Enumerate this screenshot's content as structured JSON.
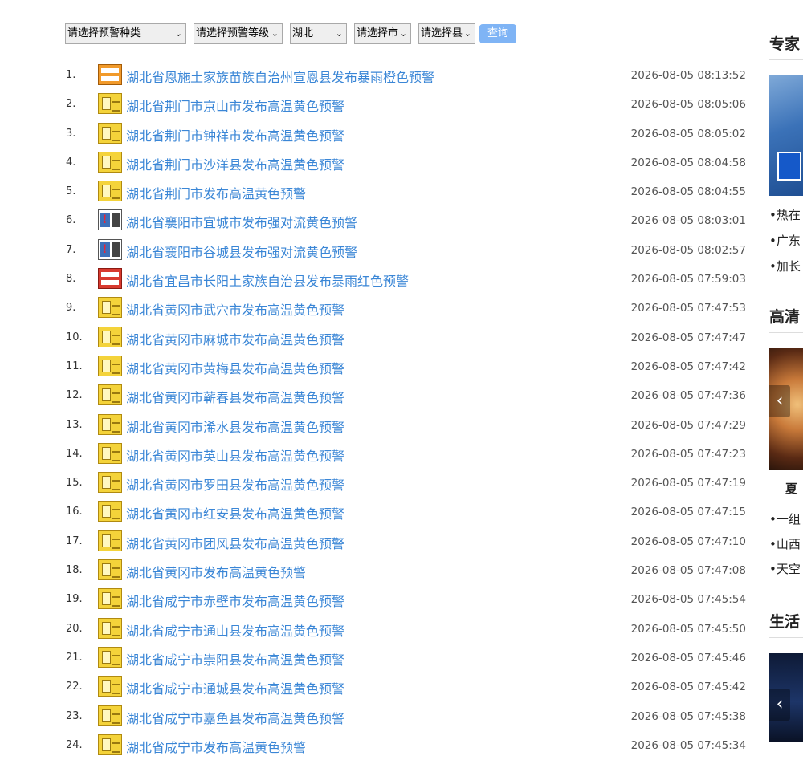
{
  "filters": {
    "category": "请选择预警种类",
    "level": "请选择预警等级",
    "province": "湖北",
    "city": "请选择市",
    "county": "请选择县",
    "query_label": "查询"
  },
  "alerts": [
    {
      "num": "1.",
      "icon": "orange-rainstorm-icon",
      "title": "湖北省恩施土家族苗族自治州宣恩县发布暴雨橙色预警",
      "time": "2026-08-05 08:13:52"
    },
    {
      "num": "2.",
      "icon": "yellow-heat-icon",
      "title": "湖北省荆门市京山市发布高温黄色预警",
      "time": "2026-08-05 08:05:06"
    },
    {
      "num": "3.",
      "icon": "yellow-heat-icon",
      "title": "湖北省荆门市钟祥市发布高温黄色预警",
      "time": "2026-08-05 08:05:02"
    },
    {
      "num": "4.",
      "icon": "yellow-heat-icon",
      "title": "湖北省荆门市沙洋县发布高温黄色预警",
      "time": "2026-08-05 08:04:58"
    },
    {
      "num": "5.",
      "icon": "yellow-heat-icon",
      "title": "湖北省荆门市发布高温黄色预警",
      "time": "2026-08-05 08:04:55"
    },
    {
      "num": "6.",
      "icon": "convection-alert-icon",
      "title": "湖北省襄阳市宜城市发布强对流黄色预警",
      "time": "2026-08-05 08:03:01"
    },
    {
      "num": "7.",
      "icon": "convection-alert-icon",
      "title": "湖北省襄阳市谷城县发布强对流黄色预警",
      "time": "2026-08-05 08:02:57"
    },
    {
      "num": "8.",
      "icon": "red-rainstorm-icon",
      "title": "湖北省宜昌市长阳土家族自治县发布暴雨红色预警",
      "time": "2026-08-05 07:59:03"
    },
    {
      "num": "9.",
      "icon": "yellow-heat-icon",
      "title": "湖北省黄冈市武穴市发布高温黄色预警",
      "time": "2026-08-05 07:47:53"
    },
    {
      "num": "10.",
      "icon": "yellow-heat-icon",
      "title": "湖北省黄冈市麻城市发布高温黄色预警",
      "time": "2026-08-05 07:47:47"
    },
    {
      "num": "11.",
      "icon": "yellow-heat-icon",
      "title": "湖北省黄冈市黄梅县发布高温黄色预警",
      "time": "2026-08-05 07:47:42"
    },
    {
      "num": "12.",
      "icon": "yellow-heat-icon",
      "title": "湖北省黄冈市蕲春县发布高温黄色预警",
      "time": "2026-08-05 07:47:36"
    },
    {
      "num": "13.",
      "icon": "yellow-heat-icon",
      "title": "湖北省黄冈市浠水县发布高温黄色预警",
      "time": "2026-08-05 07:47:29"
    },
    {
      "num": "14.",
      "icon": "yellow-heat-icon",
      "title": "湖北省黄冈市英山县发布高温黄色预警",
      "time": "2026-08-05 07:47:23"
    },
    {
      "num": "15.",
      "icon": "yellow-heat-icon",
      "title": "湖北省黄冈市罗田县发布高温黄色预警",
      "time": "2026-08-05 07:47:19"
    },
    {
      "num": "16.",
      "icon": "yellow-heat-icon",
      "title": "湖北省黄冈市红安县发布高温黄色预警",
      "time": "2026-08-05 07:47:15"
    },
    {
      "num": "17.",
      "icon": "yellow-heat-icon",
      "title": "湖北省黄冈市团风县发布高温黄色预警",
      "time": "2026-08-05 07:47:10"
    },
    {
      "num": "18.",
      "icon": "yellow-heat-icon",
      "title": "湖北省黄冈市发布高温黄色预警",
      "time": "2026-08-05 07:47:08"
    },
    {
      "num": "19.",
      "icon": "yellow-heat-icon",
      "title": "湖北省咸宁市赤壁市发布高温黄色预警",
      "time": "2026-08-05 07:45:54"
    },
    {
      "num": "20.",
      "icon": "yellow-heat-icon",
      "title": "湖北省咸宁市通山县发布高温黄色预警",
      "time": "2026-08-05 07:45:50"
    },
    {
      "num": "21.",
      "icon": "yellow-heat-icon",
      "title": "湖北省咸宁市崇阳县发布高温黄色预警",
      "time": "2026-08-05 07:45:46"
    },
    {
      "num": "22.",
      "icon": "yellow-heat-icon",
      "title": "湖北省咸宁市通城县发布高温黄色预警",
      "time": "2026-08-05 07:45:42"
    },
    {
      "num": "23.",
      "icon": "yellow-heat-icon",
      "title": "湖北省咸宁市嘉鱼县发布高温黄色预警",
      "time": "2026-08-05 07:45:38"
    },
    {
      "num": "24.",
      "icon": "yellow-heat-icon",
      "title": "湖北省咸宁市发布高温黄色预警",
      "time": "2026-08-05 07:45:34"
    }
  ],
  "right": {
    "head1": "专家",
    "bullets1": [
      "•热在",
      "•广东",
      "•加长"
    ],
    "head2": "高清",
    "caption": "夏",
    "bullets2": [
      "•一组",
      "•山西",
      "•天空"
    ],
    "head3": "生活",
    "arrow": "‹"
  }
}
